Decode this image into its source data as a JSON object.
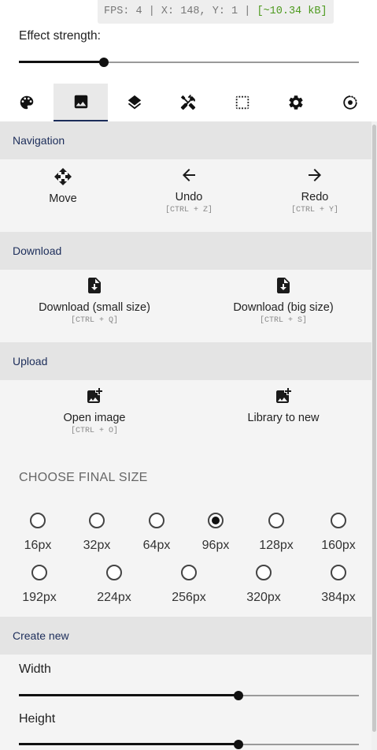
{
  "status": {
    "fps": "FPS: 4 | X: 148, Y: 1 |",
    "size": "[~10.34 kB]"
  },
  "effect": {
    "label": "Effect strength:",
    "value": 0.25
  },
  "tabs": [
    {
      "icon": "palette-icon",
      "active": false
    },
    {
      "icon": "image-icon",
      "active": true
    },
    {
      "icon": "layers-icon",
      "active": false
    },
    {
      "icon": "tools-icon",
      "active": false
    },
    {
      "icon": "selection-icon",
      "active": false
    },
    {
      "icon": "gear-icon",
      "active": false
    },
    {
      "icon": "record-icon",
      "active": false
    }
  ],
  "navigation": {
    "title": "Navigation",
    "move": {
      "label": "Move"
    },
    "undo": {
      "label": "Undo",
      "shortcut": "[CTRL + Z]"
    },
    "redo": {
      "label": "Redo",
      "shortcut": "[CTRL + Y]"
    }
  },
  "download": {
    "title": "Download",
    "small": {
      "label": "Download (small size)",
      "shortcut": "[CTRL + Q]"
    },
    "big": {
      "label": "Download (big size)",
      "shortcut": "[CTRL + S]"
    }
  },
  "upload": {
    "title": "Upload",
    "open": {
      "label": "Open image",
      "shortcut": "[CTRL + O]"
    },
    "library": {
      "label": "Library to new"
    }
  },
  "final_size": {
    "title": "CHOOSE FINAL SIZE",
    "options": [
      "16px",
      "32px",
      "64px",
      "96px",
      "128px",
      "160px",
      "192px",
      "224px",
      "256px",
      "320px",
      "384px"
    ],
    "selected": "96px"
  },
  "create_new": {
    "title": "Create new",
    "width": {
      "label": "Width",
      "value": 0.645
    },
    "height": {
      "label": "Height",
      "value": 0.645
    }
  }
}
